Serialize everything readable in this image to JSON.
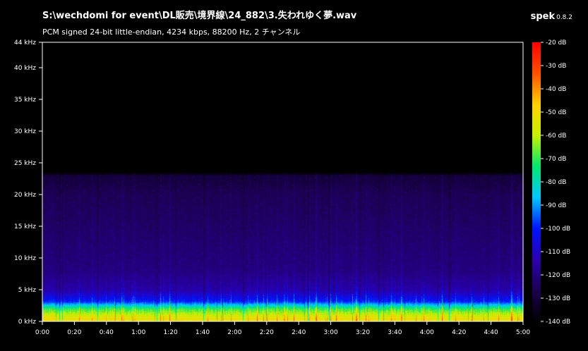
{
  "window": {
    "title": "S:\\wechdomi for event\\DL販売\\境界線\\24_882\\3.失われゆく夢.wav",
    "subtitle": "PCM signed 24-bit little-endian, 4234 kbps, 88200 Hz, 2 チャンネル",
    "app_name": "spek",
    "app_version": "0.8.2"
  },
  "colors": {
    "background": "#000000",
    "axis": "#ffffff"
  },
  "chart_data": {
    "type": "heatmap",
    "title": "",
    "xlabel": "",
    "ylabel": "",
    "y_ticks": [
      "0 kHz",
      "5 kHz",
      "10 kHz",
      "15 kHz",
      "20 kHz",
      "25 kHz",
      "30 kHz",
      "35 kHz",
      "40 kHz",
      "44 kHz"
    ],
    "y_values_khz": [
      0,
      5,
      10,
      15,
      20,
      25,
      30,
      35,
      40,
      44
    ],
    "x_ticks": [
      "0:00",
      "0:20",
      "0:40",
      "1:00",
      "1:20",
      "1:40",
      "2:00",
      "2:20",
      "2:40",
      "3:00",
      "3:20",
      "3:40",
      "4:00",
      "4:20",
      "4:40",
      "5:00"
    ],
    "x_values_sec": [
      0,
      20,
      40,
      60,
      80,
      100,
      120,
      140,
      160,
      180,
      200,
      220,
      240,
      260,
      280,
      300
    ],
    "xlim_sec": [
      0,
      300
    ],
    "ylim_khz": [
      0,
      44
    ],
    "signal_cutoff_khz": 23.5,
    "colorbar": {
      "ticks": [
        "-20 dB",
        "-30 dB",
        "-40 dB",
        "-50 dB",
        "-60 dB",
        "-70 dB",
        "-80 dB",
        "-90 dB",
        "-100 dB",
        "-110 dB",
        "-120 dB",
        "-130 dB",
        "-140 dB"
      ],
      "values_db": [
        -20,
        -30,
        -40,
        -50,
        -60,
        -70,
        -80,
        -90,
        -100,
        -110,
        -120,
        -130,
        -140
      ],
      "range_db": [
        -140,
        -20
      ],
      "stops": [
        "#000000",
        "#1c0050",
        "#2a00b0",
        "#0014ff",
        "#00c8ff",
        "#00e870",
        "#c8f000",
        "#ffd000",
        "#ff5000",
        "#ff0000"
      ]
    },
    "energy_profile": [
      {
        "khz": 0,
        "db": -50
      },
      {
        "khz": 0.8,
        "db": -55
      },
      {
        "khz": 2,
        "db": -70
      },
      {
        "khz": 3.2,
        "db": -100
      },
      {
        "khz": 5,
        "db": -114
      },
      {
        "khz": 8,
        "db": -120
      },
      {
        "khz": 14,
        "db": -123
      },
      {
        "khz": 20,
        "db": -126
      },
      {
        "khz": 23,
        "db": -130
      },
      {
        "khz": 23.5,
        "db": -140
      }
    ]
  }
}
